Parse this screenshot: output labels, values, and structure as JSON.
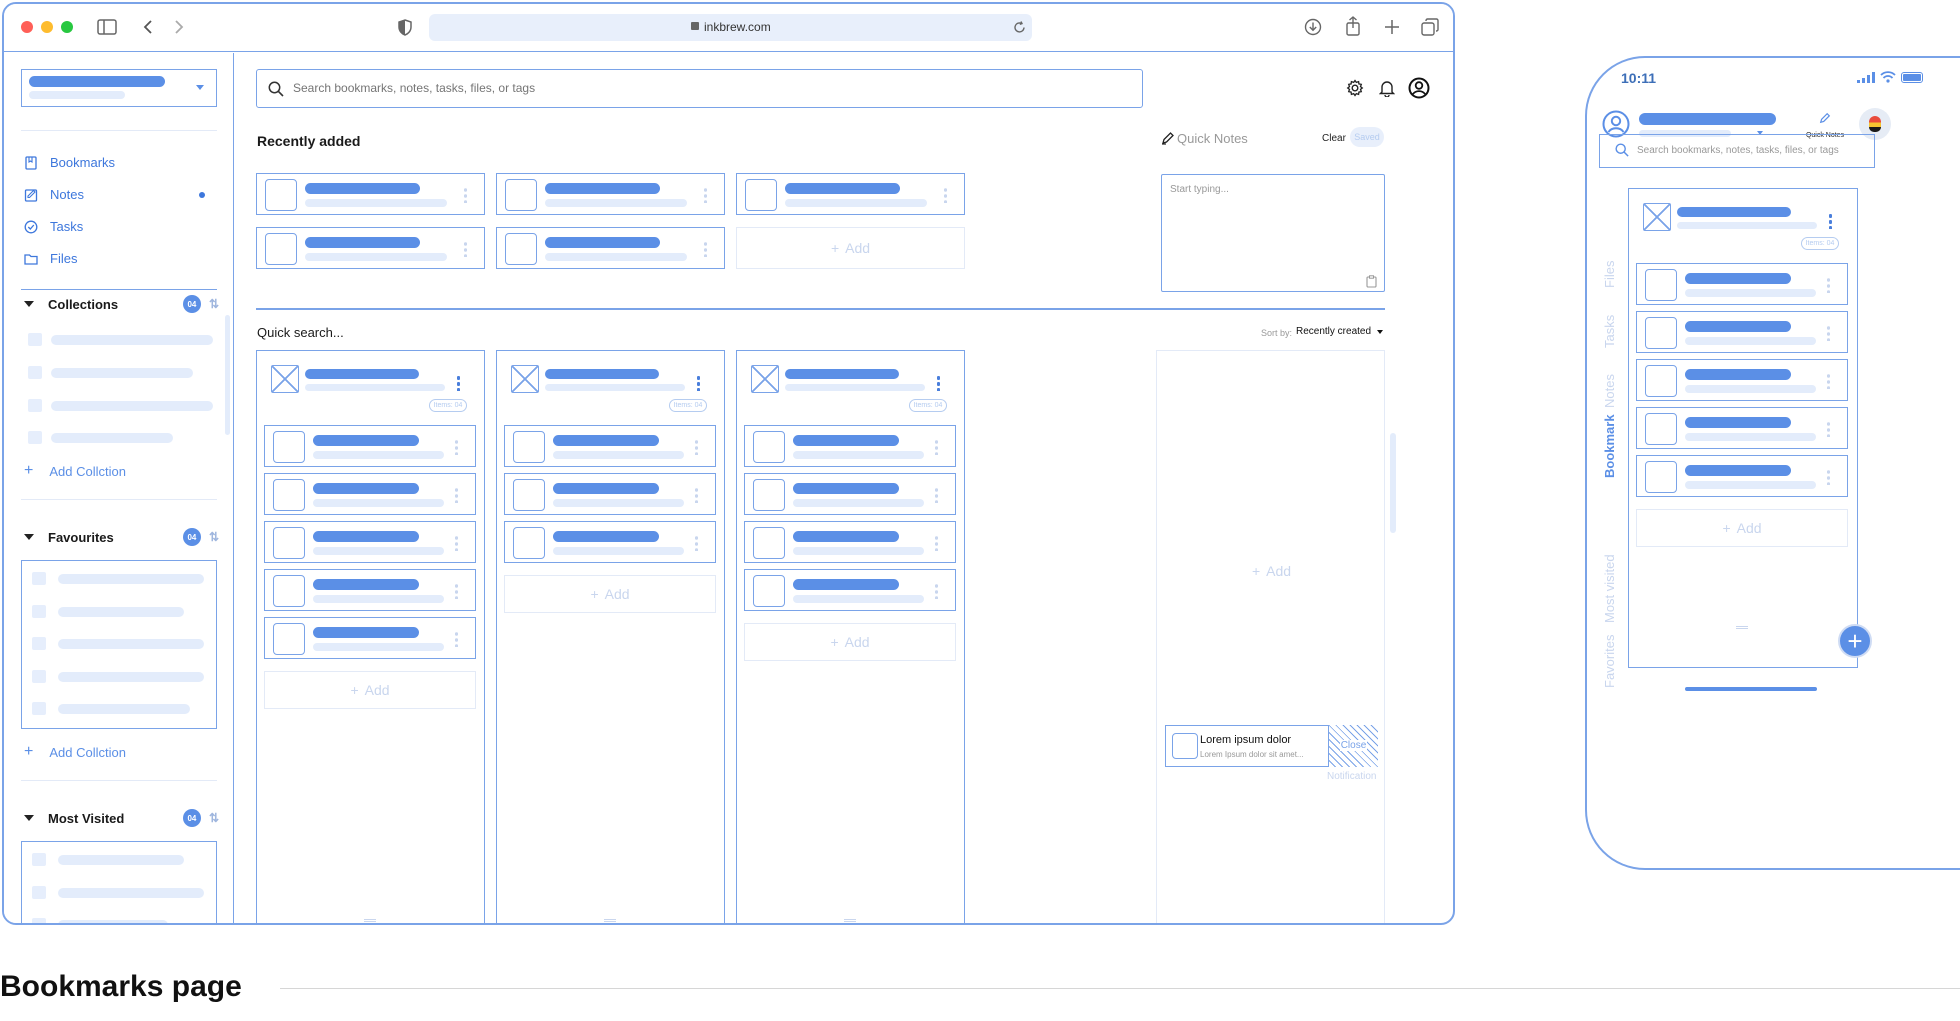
{
  "browser": {
    "url": "inkbrew.com"
  },
  "search": {
    "placeholder": "Search bookmarks, notes, tasks, files, or tags"
  },
  "sidebar": {
    "nav": [
      {
        "label": "Bookmarks",
        "icon": "bookmark-icon"
      },
      {
        "label": "Notes",
        "icon": "note-icon"
      },
      {
        "label": "Tasks",
        "icon": "task-icon"
      },
      {
        "label": "Files",
        "icon": "folder-icon"
      }
    ],
    "collections": {
      "title": "Collections",
      "count": "04",
      "add_label": "Add Collction"
    },
    "favourites": {
      "title": "Favourites",
      "count": "04",
      "add_label": "Add Collction"
    },
    "most_visited": {
      "title": "Most Visited",
      "count": "04"
    }
  },
  "main": {
    "recently_added": "Recently added",
    "add_label": "Add",
    "quick_search": "Quick search...",
    "sort_by_label": "Sort by:",
    "sort_by_value": "Recently created",
    "items_badge": "Items: 04"
  },
  "quick_notes": {
    "title": "Quick Notes",
    "clear": "Clear",
    "saved": "Saved",
    "placeholder": "Start typing..."
  },
  "notification": {
    "title": "Lorem ipsum dolor",
    "body": "Lorem Ipsum dolor sit amet...",
    "close": "Close",
    "caption": "Notification"
  },
  "mobile": {
    "time": "10:11",
    "quick_notes": "Quick Notes",
    "search_placeholder": "Search bookmarks, notes, tasks, files, or tags",
    "side_tabs": [
      "Files",
      "Tasks",
      "Notes",
      "Bookmark",
      "Most visited",
      "Favorites"
    ],
    "items_badge": "Items: 04",
    "add_label": "Add"
  },
  "page": {
    "caption": "Bookmarks page"
  },
  "colors": {
    "accent": "#5b8fe6",
    "border": "#7aa3e8",
    "skeleton": "#e3ecfb"
  }
}
